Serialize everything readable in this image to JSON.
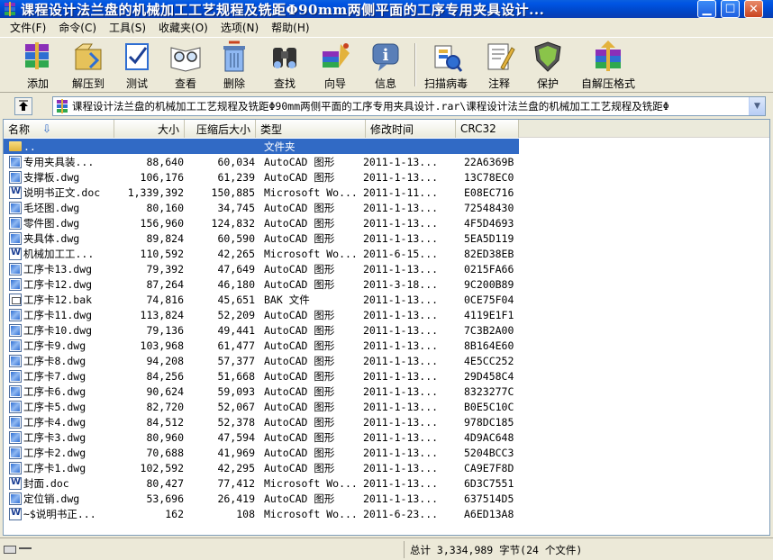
{
  "window": {
    "title": "课程设计法兰盘的机械加工工艺规程及铣距Φ90mm两侧平面的工序专用夹具设计..."
  },
  "menu": [
    "文件(F)",
    "命令(C)",
    "工具(S)",
    "收藏夹(O)",
    "选项(N)",
    "帮助(H)"
  ],
  "toolbar": [
    {
      "label": "添加",
      "icon": "add-archive-icon"
    },
    {
      "label": "解压到",
      "icon": "extract-to-icon"
    },
    {
      "label": "测试",
      "icon": "test-icon"
    },
    {
      "label": "查看",
      "icon": "view-icon"
    },
    {
      "label": "删除",
      "icon": "delete-icon"
    },
    {
      "label": "查找",
      "icon": "find-icon"
    },
    {
      "label": "向导",
      "icon": "wizard-icon"
    },
    {
      "label": "信息",
      "icon": "info-icon"
    },
    {
      "label": "扫描病毒",
      "icon": "scan-virus-icon"
    },
    {
      "label": "注释",
      "icon": "comment-icon"
    },
    {
      "label": "保护",
      "icon": "protect-icon"
    },
    {
      "label": "自解压格式",
      "icon": "sfx-icon"
    }
  ],
  "address": {
    "path": "课程设计法兰盘的机械加工工艺规程及铣距Φ90mm两侧平面的工序专用夹具设计.rar\\课程设计法兰盘的机械加工工艺规程及铣距Φ"
  },
  "columns": {
    "name": "名称",
    "size": "大小",
    "packed": "压缩后大小",
    "type": "类型",
    "modified": "修改时间",
    "crc": "CRC32"
  },
  "files": [
    {
      "name": "..",
      "size": "",
      "packed": "",
      "type": "文件夹",
      "modified": "",
      "crc": "",
      "icon": "folder",
      "selected": true
    },
    {
      "name": "专用夹具装...",
      "size": "88,640",
      "packed": "60,034",
      "type": "AutoCAD 图形",
      "modified": "2011-1-13...",
      "crc": "22A6369B",
      "icon": "dwg"
    },
    {
      "name": "支撑板.dwg",
      "size": "106,176",
      "packed": "61,239",
      "type": "AutoCAD 图形",
      "modified": "2011-1-13...",
      "crc": "13C78EC0",
      "icon": "dwg"
    },
    {
      "name": "说明书正文.doc",
      "size": "1,339,392",
      "packed": "150,885",
      "type": "Microsoft Wo...",
      "modified": "2011-1-11...",
      "crc": "E08EC716",
      "icon": "doc"
    },
    {
      "name": "毛坯图.dwg",
      "size": "80,160",
      "packed": "34,745",
      "type": "AutoCAD 图形",
      "modified": "2011-1-13...",
      "crc": "72548430",
      "icon": "dwg"
    },
    {
      "name": "零件图.dwg",
      "size": "156,960",
      "packed": "124,832",
      "type": "AutoCAD 图形",
      "modified": "2011-1-13...",
      "crc": "4F5D4693",
      "icon": "dwg"
    },
    {
      "name": "夹具体.dwg",
      "size": "89,824",
      "packed": "60,590",
      "type": "AutoCAD 图形",
      "modified": "2011-1-13...",
      "crc": "5EA5D119",
      "icon": "dwg"
    },
    {
      "name": "机械加工工...",
      "size": "110,592",
      "packed": "42,265",
      "type": "Microsoft Wo...",
      "modified": "2011-6-15...",
      "crc": "82ED38EB",
      "icon": "doc"
    },
    {
      "name": "工序卡13.dwg",
      "size": "79,392",
      "packed": "47,649",
      "type": "AutoCAD 图形",
      "modified": "2011-1-13...",
      "crc": "0215FA66",
      "icon": "dwg"
    },
    {
      "name": "工序卡12.dwg",
      "size": "87,264",
      "packed": "46,180",
      "type": "AutoCAD 图形",
      "modified": "2011-3-18...",
      "crc": "9C200B89",
      "icon": "dwg"
    },
    {
      "name": "工序卡12.bak",
      "size": "74,816",
      "packed": "45,651",
      "type": "BAK 文件",
      "modified": "2011-1-13...",
      "crc": "0CE75F04",
      "icon": "bak"
    },
    {
      "name": "工序卡11.dwg",
      "size": "113,824",
      "packed": "52,209",
      "type": "AutoCAD 图形",
      "modified": "2011-1-13...",
      "crc": "4119E1F1",
      "icon": "dwg"
    },
    {
      "name": "工序卡10.dwg",
      "size": "79,136",
      "packed": "49,441",
      "type": "AutoCAD 图形",
      "modified": "2011-1-13...",
      "crc": "7C3B2A00",
      "icon": "dwg"
    },
    {
      "name": "工序卡9.dwg",
      "size": "103,968",
      "packed": "61,477",
      "type": "AutoCAD 图形",
      "modified": "2011-1-13...",
      "crc": "8B164E60",
      "icon": "dwg"
    },
    {
      "name": "工序卡8.dwg",
      "size": "94,208",
      "packed": "57,377",
      "type": "AutoCAD 图形",
      "modified": "2011-1-13...",
      "crc": "4E5CC252",
      "icon": "dwg"
    },
    {
      "name": "工序卡7.dwg",
      "size": "84,256",
      "packed": "51,668",
      "type": "AutoCAD 图形",
      "modified": "2011-1-13...",
      "crc": "29D458C4",
      "icon": "dwg"
    },
    {
      "name": "工序卡6.dwg",
      "size": "90,624",
      "packed": "59,093",
      "type": "AutoCAD 图形",
      "modified": "2011-1-13...",
      "crc": "8323277C",
      "icon": "dwg"
    },
    {
      "name": "工序卡5.dwg",
      "size": "82,720",
      "packed": "52,067",
      "type": "AutoCAD 图形",
      "modified": "2011-1-13...",
      "crc": "B0E5C10C",
      "icon": "dwg"
    },
    {
      "name": "工序卡4.dwg",
      "size": "84,512",
      "packed": "52,378",
      "type": "AutoCAD 图形",
      "modified": "2011-1-13...",
      "crc": "978DC185",
      "icon": "dwg"
    },
    {
      "name": "工序卡3.dwg",
      "size": "80,960",
      "packed": "47,594",
      "type": "AutoCAD 图形",
      "modified": "2011-1-13...",
      "crc": "4D9AC648",
      "icon": "dwg"
    },
    {
      "name": "工序卡2.dwg",
      "size": "70,688",
      "packed": "41,969",
      "type": "AutoCAD 图形",
      "modified": "2011-1-13...",
      "crc": "5204BCC3",
      "icon": "dwg"
    },
    {
      "name": "工序卡1.dwg",
      "size": "102,592",
      "packed": "42,295",
      "type": "AutoCAD 图形",
      "modified": "2011-1-13...",
      "crc": "CA9E7F8D",
      "icon": "dwg"
    },
    {
      "name": "封面.doc",
      "size": "80,427",
      "packed": "77,412",
      "type": "Microsoft Wo...",
      "modified": "2011-1-13...",
      "crc": "6D3C7551",
      "icon": "doc"
    },
    {
      "name": "定位销.dwg",
      "size": "53,696",
      "packed": "26,419",
      "type": "AutoCAD 图形",
      "modified": "2011-1-13...",
      "crc": "637514D5",
      "icon": "dwg"
    },
    {
      "name": "~$说明书正...",
      "size": "162",
      "packed": "108",
      "type": "Microsoft Wo...",
      "modified": "2011-6-23...",
      "crc": "A6ED13A8",
      "icon": "doc"
    }
  ],
  "status": {
    "total": "总计 3,334,989 字节(24 个文件)"
  },
  "colors": {
    "titlebar": "#0054e3",
    "selection": "#316ac5",
    "chrome": "#ece9d8"
  }
}
